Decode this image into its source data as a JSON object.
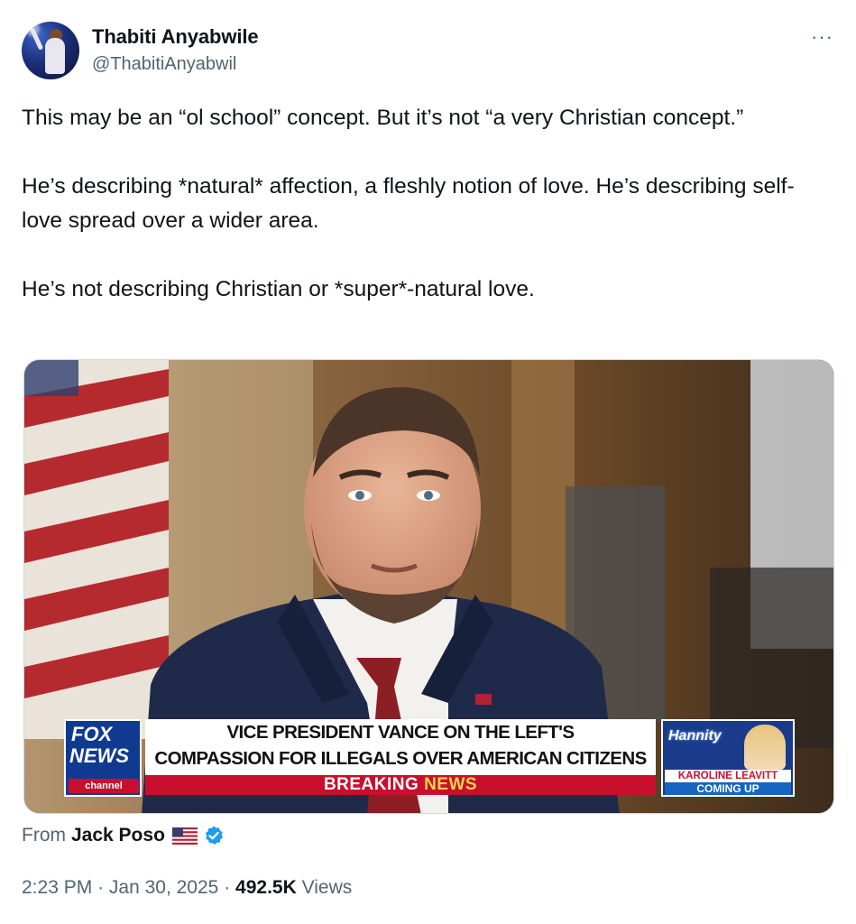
{
  "author": {
    "name": "Thabiti Anyabwile",
    "handle": "@ThabitiAnyabwil"
  },
  "more_label": "···",
  "post": {
    "paragraphs": [
      "This may be an “ol school” concept. But it’s not “a very Christian concept.”",
      "He’s describing *natural* affection, a fleshly notion of love. He’s describing self-love spread over a wider area.",
      "He’s not describing Christian or *super*-natural love."
    ]
  },
  "media": {
    "lower_third": {
      "logo_fox": "FOX",
      "logo_news": "NEWS",
      "logo_channel": "channel",
      "headline_line1": "VICE PRESIDENT VANCE ON THE LEFT'S",
      "headline_line2": "COMPASSION FOR ILLEGALS OVER AMERICAN CITIZENS",
      "banner_word1": "BREAKING",
      "banner_word2": "NEWS",
      "promo_show": "Hannity",
      "promo_guest": "KAROLINE LEAVITT",
      "promo_status": "COMING UP"
    }
  },
  "source": {
    "prefix": "From",
    "name": "Jack Poso",
    "flag_icon": "us-flag-icon",
    "verified_icon": "verified-badge-icon"
  },
  "meta": {
    "time": "2:23 PM",
    "sep1": "·",
    "date": "Jan 30, 2025",
    "sep2": "·",
    "views_count": "492.5K",
    "views_label": "Views"
  },
  "colors": {
    "text_primary": "#0f1419",
    "text_secondary": "#536471",
    "verified_blue": "#1d9bf0",
    "fox_blue": "#103a8f",
    "fox_red": "#c8102e",
    "breaking_yellow": "#f7d44a"
  }
}
